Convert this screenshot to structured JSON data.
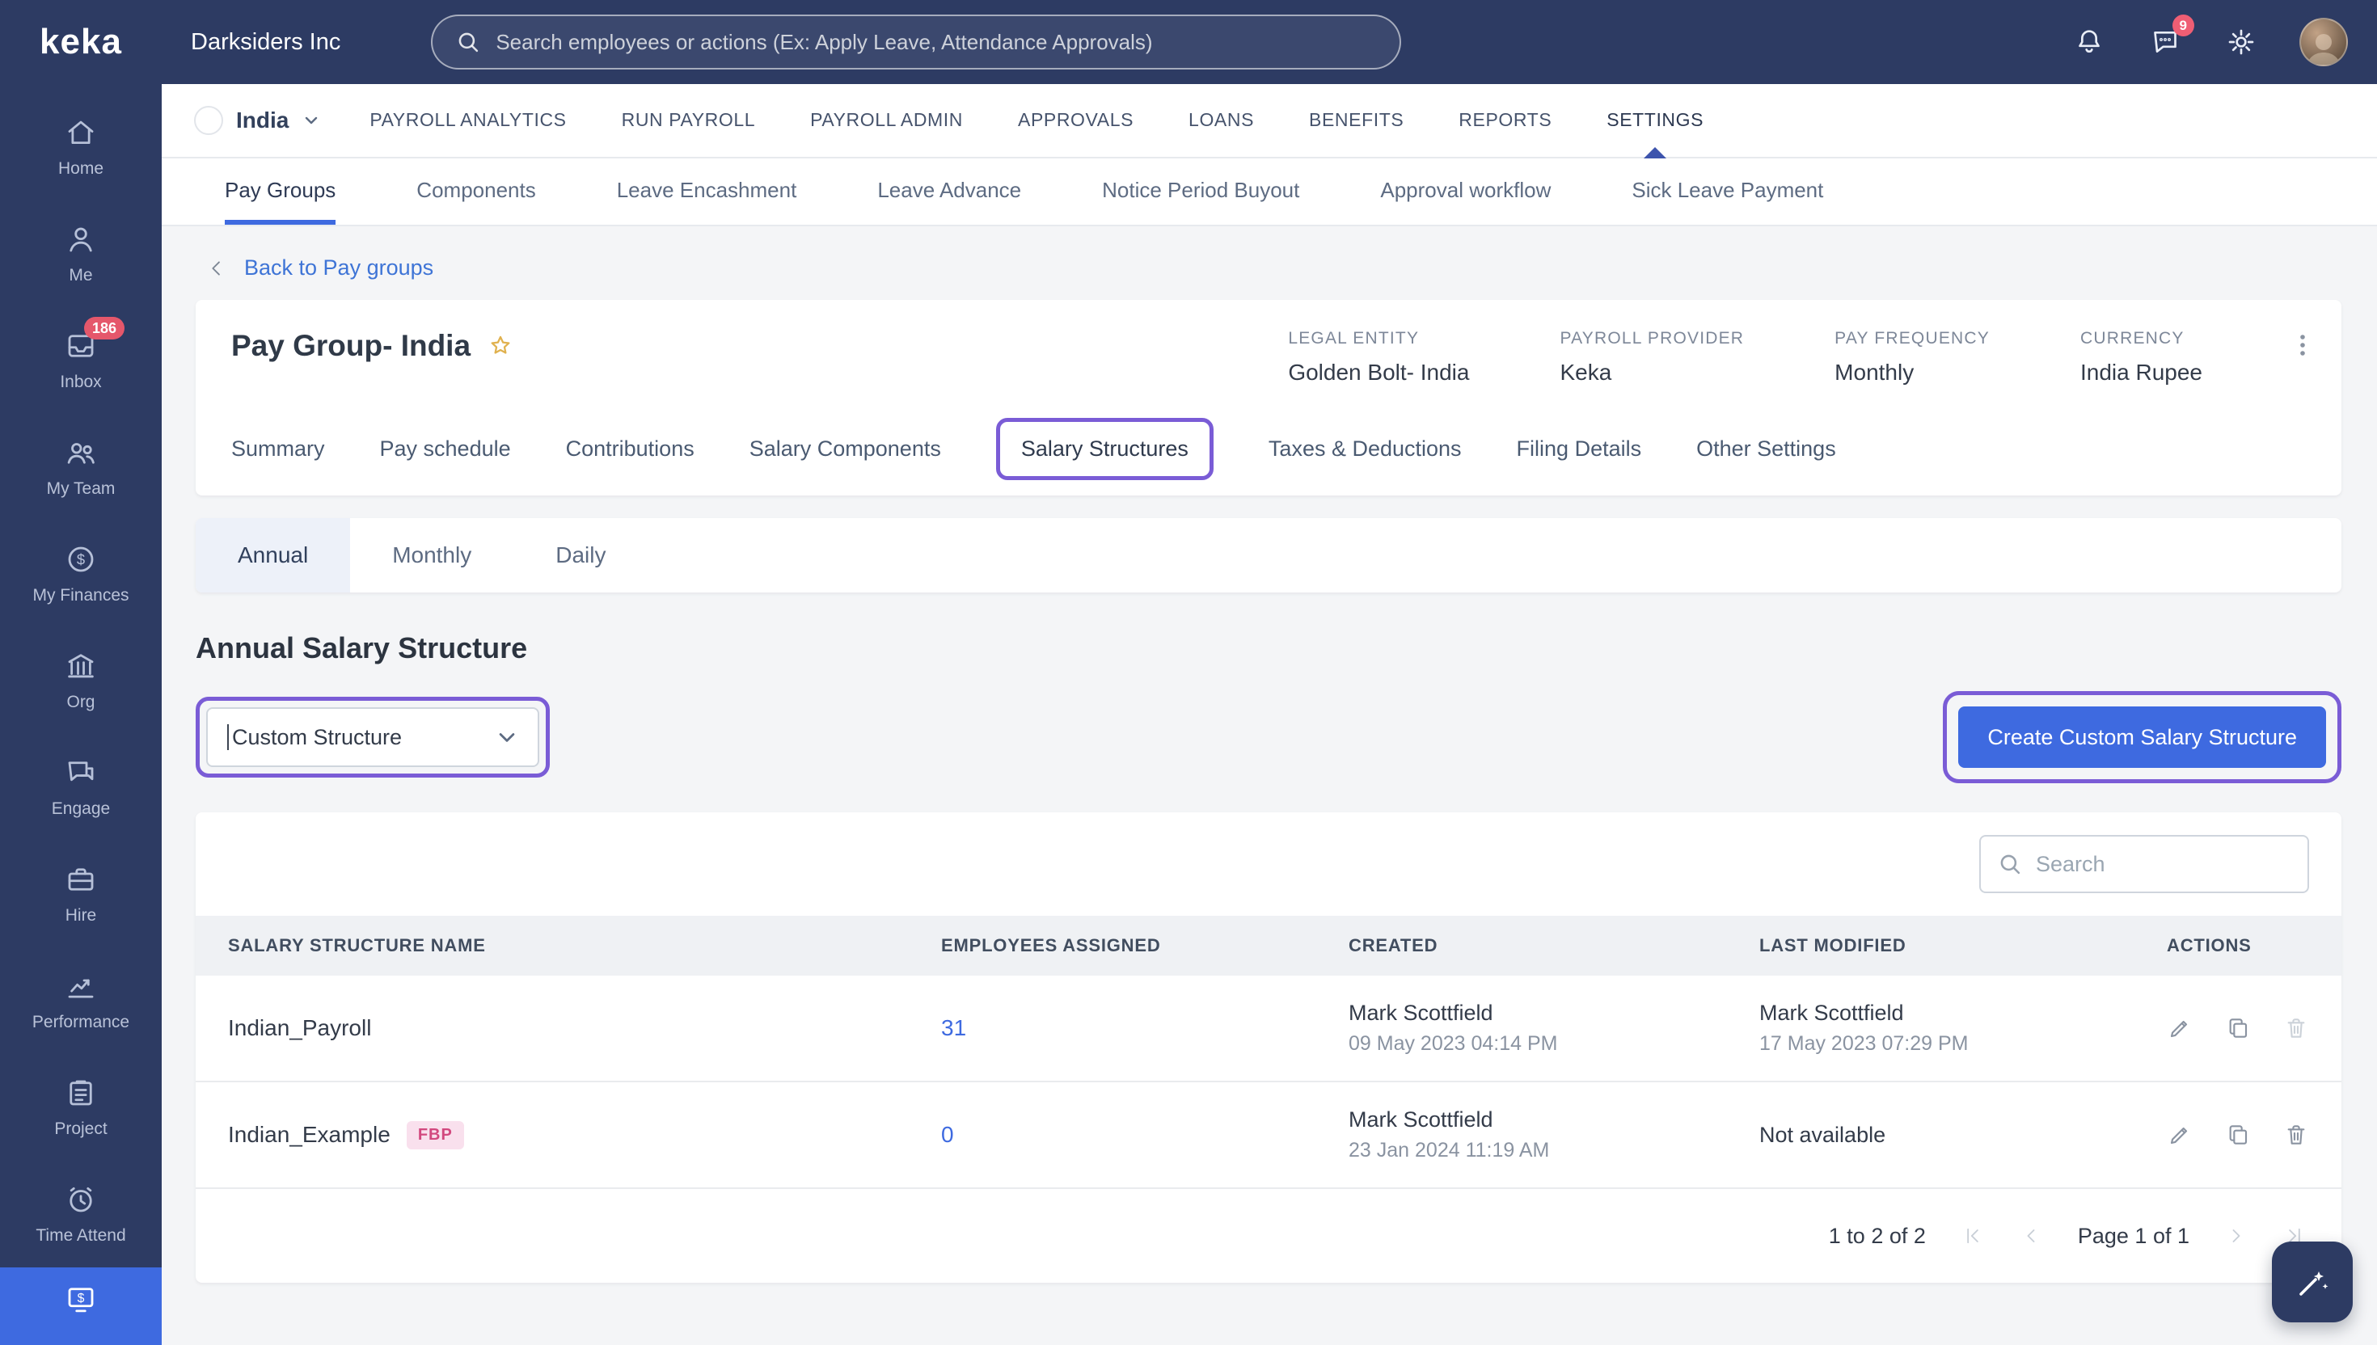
{
  "colors": {
    "brand_navy": "#2d3b63",
    "accent_blue": "#3e6ae0",
    "annotation_purple": "#7a5cd6",
    "inbox_badge_red": "#e5576b",
    "fbp_pink": "#d2487e"
  },
  "topbar": {
    "logo": "keka",
    "company": "Darksiders Inc",
    "search_placeholder": "Search employees or actions (Ex: Apply Leave, Attendance Approvals)",
    "chat_badge": "9"
  },
  "sidebar": {
    "items": [
      {
        "label": "Home"
      },
      {
        "label": "Me"
      },
      {
        "label": "Inbox",
        "badge": "186"
      },
      {
        "label": "My Team"
      },
      {
        "label": "My Finances"
      },
      {
        "label": "Org"
      },
      {
        "label": "Engage"
      },
      {
        "label": "Hire"
      },
      {
        "label": "Performance"
      },
      {
        "label": "Project"
      },
      {
        "label": "Time Attend"
      }
    ]
  },
  "modulenav": {
    "country": "India",
    "items": [
      "PAYROLL ANALYTICS",
      "RUN PAYROLL",
      "PAYROLL ADMIN",
      "APPROVALS",
      "LOANS",
      "BENEFITS",
      "REPORTS",
      "SETTINGS"
    ],
    "active": "SETTINGS"
  },
  "subnav": {
    "items": [
      "Pay Groups",
      "Components",
      "Leave Encashment",
      "Leave Advance",
      "Notice Period Buyout",
      "Approval workflow",
      "Sick Leave Payment"
    ],
    "active": "Pay Groups"
  },
  "back_link": "Back to Pay groups",
  "paygroup": {
    "title": "Pay Group- India",
    "meta": [
      {
        "label": "LEGAL ENTITY",
        "value": "Golden Bolt- India"
      },
      {
        "label": "PAYROLL PROVIDER",
        "value": "Keka"
      },
      {
        "label": "PAY FREQUENCY",
        "value": "Monthly"
      },
      {
        "label": "CURRENCY",
        "value": "India Rupee"
      }
    ],
    "tabs": [
      "Summary",
      "Pay schedule",
      "Contributions",
      "Salary Components",
      "Salary Structures",
      "Taxes & Deductions",
      "Filing Details",
      "Other Settings"
    ],
    "active_tab": "Salary Structures"
  },
  "period_tabs": {
    "items": [
      "Annual",
      "Monthly",
      "Daily"
    ],
    "active": "Annual"
  },
  "section": {
    "heading": "Annual Salary Structure",
    "structure_filter_value": "Custom Structure",
    "create_button": "Create Custom Salary Structure",
    "search_placeholder": "Search"
  },
  "table": {
    "headers": [
      "SALARY STRUCTURE NAME",
      "EMPLOYEES ASSIGNED",
      "CREATED",
      "LAST MODIFIED",
      "ACTIONS"
    ],
    "rows": [
      {
        "name": "Indian_Payroll",
        "employees_assigned": "31",
        "created_by": "Mark Scottfield",
        "created_at": "09 May 2023 04:14 PM",
        "modified_by": "Mark Scottfield",
        "modified_at": "17 May 2023 07:29 PM"
      },
      {
        "name": "Indian_Example",
        "badge": "FBP",
        "employees_assigned": "0",
        "created_by": "Mark Scottfield",
        "created_at": "23 Jan 2024 11:19 AM",
        "modified_by": "Not available",
        "modified_at": ""
      }
    ],
    "pagination": {
      "range_label": "1 to 2 of 2",
      "page_label": "Page 1 of 1"
    }
  }
}
